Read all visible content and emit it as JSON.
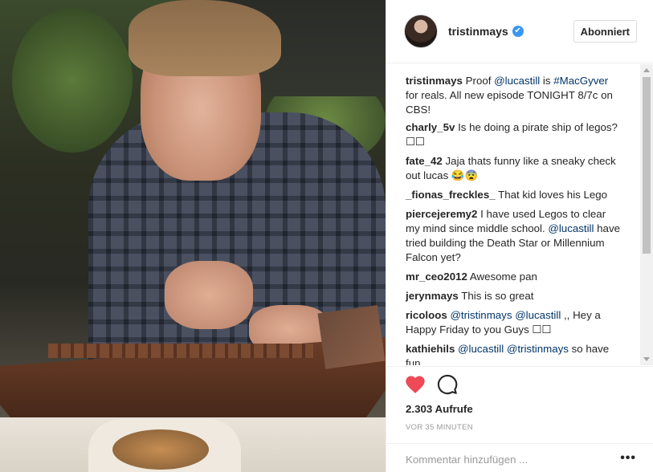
{
  "post": {
    "username": "tristinmays",
    "verified_icon": "✔",
    "follow_label": "Abonniert"
  },
  "comments": [
    {
      "user": "tristinmays",
      "parts": [
        {
          "t": " Proof "
        },
        {
          "t": "@lucastill",
          "m": true
        },
        {
          "t": " is "
        },
        {
          "t": "#MacGyver",
          "m": true
        },
        {
          "t": " for reals. All new episode TONIGHT 8/7c on CBS!"
        }
      ]
    },
    {
      "user": "charly_5v",
      "parts": [
        {
          "t": " Is he doing a pirate ship of legos? ☐☐"
        }
      ]
    },
    {
      "user": "fate_42",
      "parts": [
        {
          "t": " Jaja thats funny like a sneaky check out lucas 😂😨"
        }
      ]
    },
    {
      "user": "_fionas_freckles_",
      "parts": [
        {
          "t": " That kid loves his Lego"
        }
      ]
    },
    {
      "user": "piercejeremy2",
      "parts": [
        {
          "t": " I have used Legos to clear my mind since middle school. "
        },
        {
          "t": "@lucastill",
          "m": true
        },
        {
          "t": " have tried building the Death Star or Millennium Falcon yet?"
        }
      ]
    },
    {
      "user": "mr_ceo2012",
      "parts": [
        {
          "t": " Awesome pan"
        }
      ]
    },
    {
      "user": "jerynmays",
      "parts": [
        {
          "t": " This is so great"
        }
      ]
    },
    {
      "user": "ricoloos",
      "parts": [
        {
          "t": " "
        },
        {
          "t": "@tristinmays",
          "m": true
        },
        {
          "t": " "
        },
        {
          "t": "@lucastill",
          "m": true
        },
        {
          "t": " ,, Hey a Happy Friday to you Guys ☐☐"
        }
      ]
    },
    {
      "user": "kathiehils",
      "parts": [
        {
          "t": " "
        },
        {
          "t": "@lucastill",
          "m": true
        },
        {
          "t": " "
        },
        {
          "t": "@tristinmays",
          "m": true
        },
        {
          "t": " so have fun"
        }
      ]
    }
  ],
  "actions": {
    "like_icon": "heart-icon",
    "comment_icon": "comment-bubble-icon",
    "like_color": "#ed4956",
    "views": "2.303 Aufrufe",
    "time": "VOR 35 MINUTEN"
  },
  "comment_box": {
    "placeholder": "Kommentar hinzufügen ...",
    "more_label": "•••"
  }
}
